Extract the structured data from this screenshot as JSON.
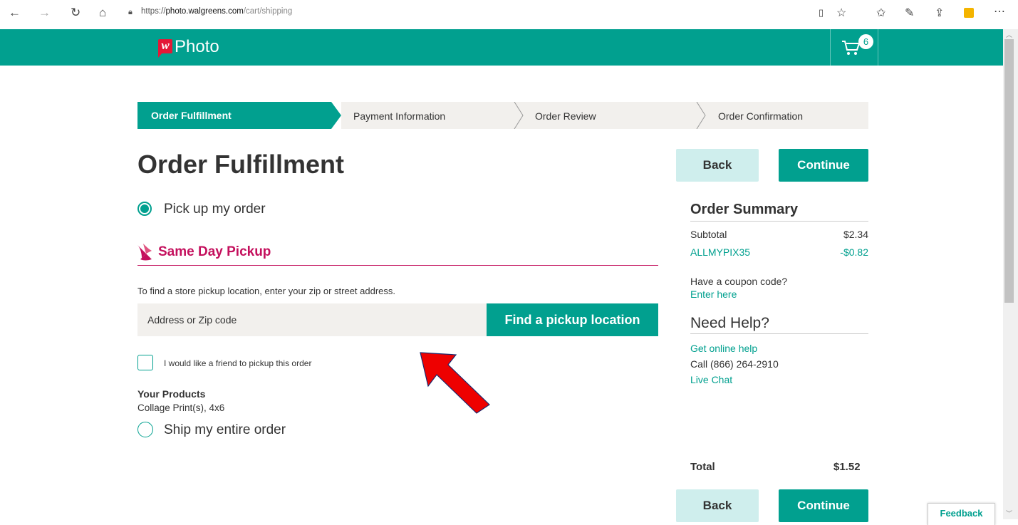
{
  "browser": {
    "url_prefix": "https://",
    "url_domain": "photo.walgreens.com",
    "url_path": "/cart/shipping"
  },
  "header": {
    "logo_letter": "w",
    "logo_text": "Photo",
    "cart_count": "6"
  },
  "steps": [
    "Order Fulfillment",
    "Payment Information",
    "Order Review",
    "Order Confirmation"
  ],
  "main": {
    "title": "Order Fulfillment",
    "pickup_label": "Pick up my order",
    "same_day_title": "Same Day Pickup",
    "instruction": "To find a store pickup location, enter your zip or street address.",
    "address_placeholder": "Address or Zip code",
    "find_button": "Find a pickup location",
    "friend_label": "I would like a friend to pickup this order",
    "your_products_title": "Your Products",
    "product": "Collage Print(s), 4x6",
    "ship_label": "Ship my entire order"
  },
  "buttons": {
    "back": "Back",
    "continue": "Continue"
  },
  "summary": {
    "title": "Order Summary",
    "subtotal_label": "Subtotal",
    "subtotal_value": "$2.34",
    "coupon_code": "ALLMYPIX35",
    "coupon_value": "-$0.82",
    "coupon_question": "Have a coupon code?",
    "coupon_link": "Enter here",
    "help_title": "Need Help?",
    "help_online": "Get online help",
    "help_phone": "Call (866) 264-2910",
    "help_chat": "Live Chat",
    "total_label": "Total",
    "total_value": "$1.52"
  },
  "feedback": "Feedback",
  "colors": {
    "teal": "#01a08f",
    "magenta": "#c4105d",
    "walgreens_red": "#e31837",
    "annotation_red": "#ee0000"
  }
}
